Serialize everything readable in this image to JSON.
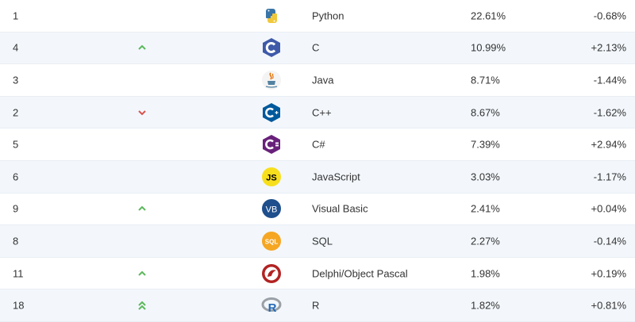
{
  "colors": {
    "row_alt": "#f3f7fc",
    "up": "#5cb85c",
    "down": "#d9534f"
  },
  "rows": [
    {
      "rank": "1",
      "trend": "none",
      "icon": "python-logo-icon",
      "name": "Python",
      "rating": "22.61%",
      "change": "-0.68%"
    },
    {
      "rank": "4",
      "trend": "up",
      "icon": "c-logo-icon",
      "name": "C",
      "rating": "10.99%",
      "change": "+2.13%"
    },
    {
      "rank": "3",
      "trend": "none",
      "icon": "java-logo-icon",
      "name": "Java",
      "rating": "8.71%",
      "change": "-1.44%"
    },
    {
      "rank": "2",
      "trend": "down",
      "icon": "cpp-logo-icon",
      "name": "C++",
      "rating": "8.67%",
      "change": "-1.62%"
    },
    {
      "rank": "5",
      "trend": "none",
      "icon": "csharp-logo-icon",
      "name": "C#",
      "rating": "7.39%",
      "change": "+2.94%"
    },
    {
      "rank": "6",
      "trend": "none",
      "icon": "javascript-logo-icon",
      "name": "JavaScript",
      "rating": "3.03%",
      "change": "-1.17%"
    },
    {
      "rank": "9",
      "trend": "up",
      "icon": "visual-basic-logo-icon",
      "name": "Visual Basic",
      "rating": "2.41%",
      "change": "+0.04%"
    },
    {
      "rank": "8",
      "trend": "none",
      "icon": "sql-logo-icon",
      "name": "SQL",
      "rating": "2.27%",
      "change": "-0.14%"
    },
    {
      "rank": "11",
      "trend": "up",
      "icon": "delphi-logo-icon",
      "name": "Delphi/Object Pascal",
      "rating": "1.98%",
      "change": "+0.19%"
    },
    {
      "rank": "18",
      "trend": "double-up",
      "icon": "r-logo-icon",
      "name": "R",
      "rating": "1.82%",
      "change": "+0.81%"
    }
  ]
}
